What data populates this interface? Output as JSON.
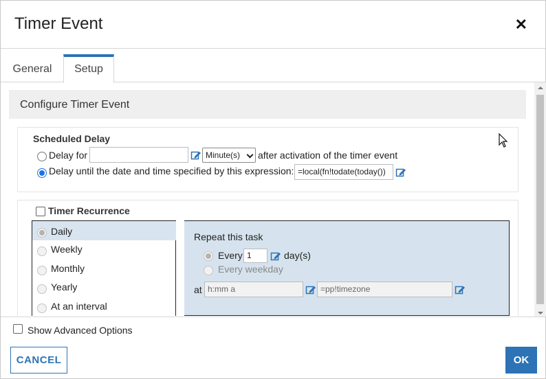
{
  "dialog": {
    "title": "Timer Event",
    "close_icon": "close-icon"
  },
  "tabs": [
    {
      "label": "General",
      "active": false
    },
    {
      "label": "Setup",
      "active": true
    }
  ],
  "section": {
    "title": "Configure Timer Event"
  },
  "scheduled_delay": {
    "heading": "Scheduled Delay",
    "delay_for_label": "Delay for",
    "delay_for_value": "",
    "unit_selected": "Minute(s)",
    "after_activation_text": "after activation of the timer event",
    "delay_until_label": "Delay until the date and time specified by this expression:",
    "delay_until_value": "=local(fn!todate(today())",
    "selected_option": "delay_until"
  },
  "recurrence": {
    "heading": "Timer Recurrence",
    "checked": false,
    "options": [
      {
        "label": "Daily",
        "selected": true
      },
      {
        "label": "Weekly",
        "selected": false
      },
      {
        "label": "Monthly",
        "selected": false
      },
      {
        "label": "Yearly",
        "selected": false
      },
      {
        "label": "At an interval",
        "selected": false
      }
    ],
    "repeat_label": "Repeat this task",
    "every_label": "Every",
    "every_value": "1",
    "days_label": "day(s)",
    "every_weekday_label": "Every weekday",
    "at_label": "at",
    "time_placeholder": "h:mm a",
    "timezone_value": "=pp!timezone"
  },
  "footer": {
    "advanced_label": "Show Advanced Options",
    "advanced_checked": false,
    "cancel_label": "CANCEL",
    "ok_label": "OK"
  },
  "colors": {
    "accent": "#2d73b5",
    "panel": "#d6e3ee",
    "header_bar": "#efefef"
  }
}
